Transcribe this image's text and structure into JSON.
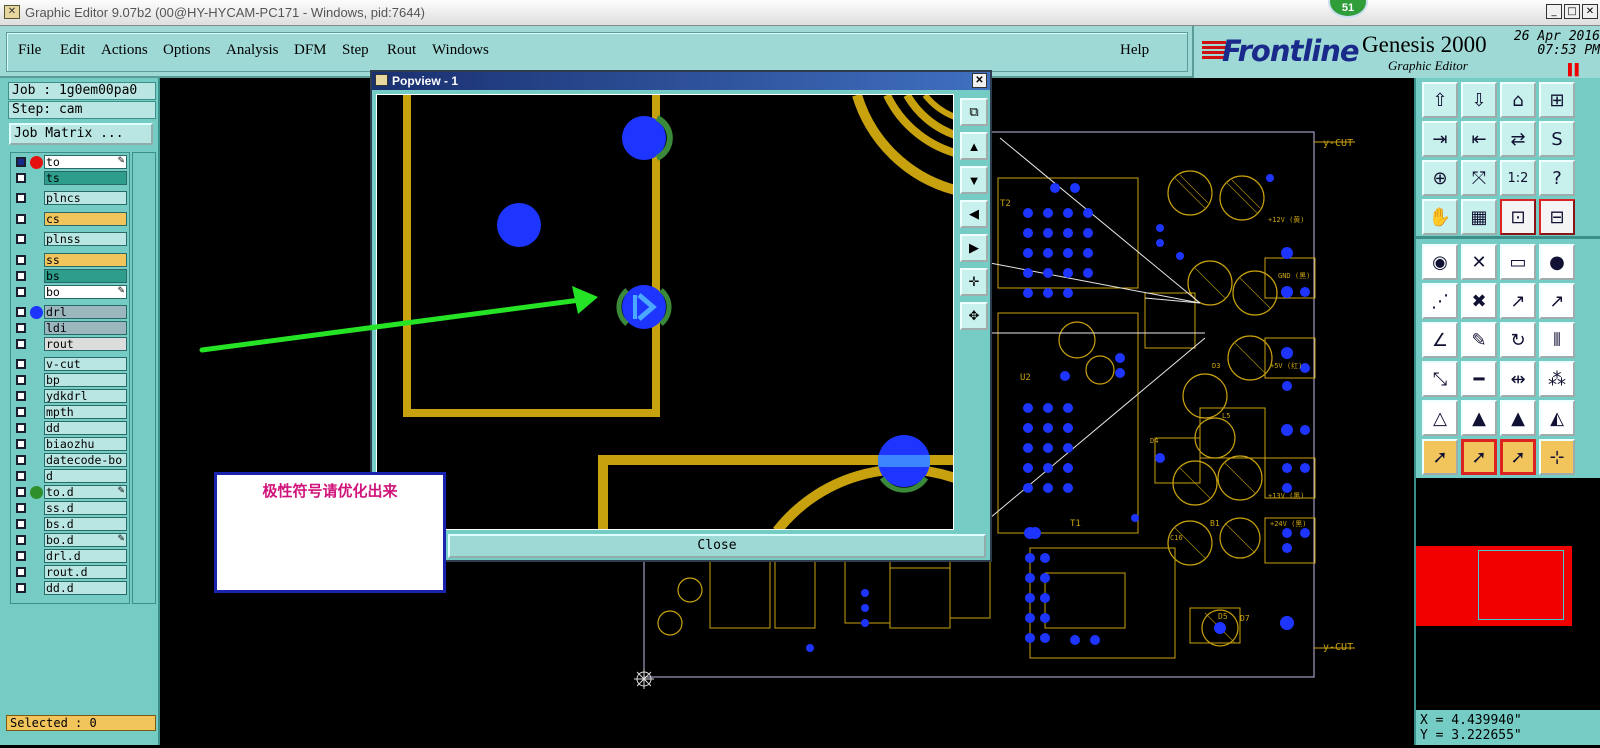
{
  "window": {
    "title": "Graphic Editor 9.07b2 (00@HY-HYCAM-PC171 - Windows, pid:7644)",
    "notification_count": "51",
    "minimize": "_",
    "maximize": "□",
    "close": "✕"
  },
  "menu": {
    "items": [
      "File",
      "Edit",
      "Actions",
      "Options",
      "Analysis",
      "DFM",
      "Step",
      "Rout",
      "Windows"
    ],
    "help": "Help"
  },
  "brand": {
    "logo": "Frontline",
    "product": "Genesis 2000",
    "subtitle": "Graphic Editor",
    "date": "26 Apr 2016",
    "time": "07:53 PM"
  },
  "job": {
    "job_label": "Job : 1g0em00pa0",
    "step_label": "Step: cam",
    "matrix_button": "Job Matrix ..."
  },
  "layers": [
    {
      "name": "to",
      "bg": "#ffffff",
      "dot": "#e51010",
      "active": true,
      "edit": true
    },
    {
      "name": "ts",
      "bg": "#2e9d8c",
      "dot": "",
      "active": false,
      "edit": false
    },
    {
      "name": "plncs",
      "bg": "#b9e6e2",
      "dot": "",
      "active": false,
      "edit": false
    },
    {
      "name": "cs",
      "bg": "#f2c45c",
      "dot": "",
      "active": false,
      "edit": false
    },
    {
      "name": "plnss",
      "bg": "#b9e6e2",
      "dot": "",
      "active": false,
      "edit": false
    },
    {
      "name": "ss",
      "bg": "#f2c45c",
      "dot": "",
      "active": false,
      "edit": false
    },
    {
      "name": "bs",
      "bg": "#2e9d8c",
      "dot": "",
      "active": false,
      "edit": false
    },
    {
      "name": "bo",
      "bg": "#ffffff",
      "dot": "",
      "active": false,
      "edit": true
    },
    {
      "name": "drl",
      "bg": "#9cb6be",
      "dot": "#1d35ff",
      "active": false,
      "edit": false
    },
    {
      "name": "ldi",
      "bg": "#9cb6be",
      "dot": "",
      "active": false,
      "edit": false
    },
    {
      "name": "rout",
      "bg": "#dcdcdc",
      "dot": "",
      "active": false,
      "edit": false
    },
    {
      "name": "v-cut",
      "bg": "#b9e6e2",
      "dot": "",
      "active": false,
      "edit": false
    },
    {
      "name": "bp",
      "bg": "#b9e6e2",
      "dot": "",
      "active": false,
      "edit": false
    },
    {
      "name": "ydkdrl",
      "bg": "#b9e6e2",
      "dot": "",
      "active": false,
      "edit": false
    },
    {
      "name": "mpth",
      "bg": "#b9e6e2",
      "dot": "",
      "active": false,
      "edit": false
    },
    {
      "name": "dd",
      "bg": "#b9e6e2",
      "dot": "",
      "active": false,
      "edit": false
    },
    {
      "name": "biaozhu",
      "bg": "#b9e6e2",
      "dot": "",
      "active": false,
      "edit": false
    },
    {
      "name": "datecode-bo",
      "bg": "#b9e6e2",
      "dot": "",
      "active": false,
      "edit": false
    },
    {
      "name": "d",
      "bg": "#b9e6e2",
      "dot": "",
      "active": false,
      "edit": false
    },
    {
      "name": "to.d",
      "bg": "#b9e6e2",
      "dot": "#2f8f2a",
      "active": false,
      "edit": true
    },
    {
      "name": "ss.d",
      "bg": "#b9e6e2",
      "dot": "",
      "active": false,
      "edit": false
    },
    {
      "name": "bs.d",
      "bg": "#b9e6e2",
      "dot": "",
      "active": false,
      "edit": false
    },
    {
      "name": "bo.d",
      "bg": "#b9e6e2",
      "dot": "",
      "active": false,
      "edit": true
    },
    {
      "name": "drl.d",
      "bg": "#b9e6e2",
      "dot": "",
      "active": false,
      "edit": false
    },
    {
      "name": "rout.d",
      "bg": "#b9e6e2",
      "dot": "",
      "active": false,
      "edit": false
    },
    {
      "name": "dd.d",
      "bg": "#b9e6e2",
      "dot": "",
      "active": false,
      "edit": false
    }
  ],
  "status": {
    "selected": "Selected : 0",
    "x": "X = 4.439940\"",
    "y": "Y = 3.222655\""
  },
  "popview": {
    "title": "Popview - 1",
    "close_button": "Close",
    "close_icon": "✕"
  },
  "note": {
    "text": "极性符号请优化出来"
  },
  "board": {
    "vcut_top": "y-CUT",
    "vcut_bottom": "y-CUT",
    "labels": [
      "T2",
      "U2",
      "T1",
      "+12V (黄)",
      "GND (黑)",
      "+5V (红)",
      "+13V (黑)",
      "+24V (黑)",
      "D5",
      "D7",
      "B1",
      "C16",
      "D4",
      "D3",
      "L5"
    ]
  },
  "toolbar": {
    "rows": [
      [
        "layer-up-icon",
        "layer-down-icon",
        "home-icon",
        "window-icon"
      ],
      [
        "enter-icon",
        "exit-icon",
        "swap-icon",
        "s-icon"
      ],
      [
        "zoom-in-icon",
        "zoom-fit-icon",
        "scale-icon",
        "help-icon"
      ],
      [
        "hand-icon",
        "grid-icon",
        "snap-icon",
        "snap-alt-icon"
      ],
      [
        "pad-icon",
        "cross-icon",
        "ruler-icon",
        "dot-icon"
      ],
      [
        "net-icon",
        "cut-icon",
        "line-icon",
        "line-alt-icon"
      ],
      [
        "angle-icon",
        "pencil-icon",
        "rotate-icon",
        "parallel-icon"
      ],
      [
        "move-icon",
        "minus-icon",
        "spread-icon",
        "group-icon"
      ],
      [
        "triangle-icon",
        "triangle-a-icon",
        "triangle-b-icon",
        "triangle-c-icon"
      ],
      [
        "select-icon",
        "select-alt-icon",
        "select-area-icon",
        "select-net-icon"
      ]
    ]
  },
  "colors": {
    "panel": "#74ccc4",
    "copper": "#c8a20e",
    "pad": "#1d35ff",
    "arrow": "#25e325"
  }
}
